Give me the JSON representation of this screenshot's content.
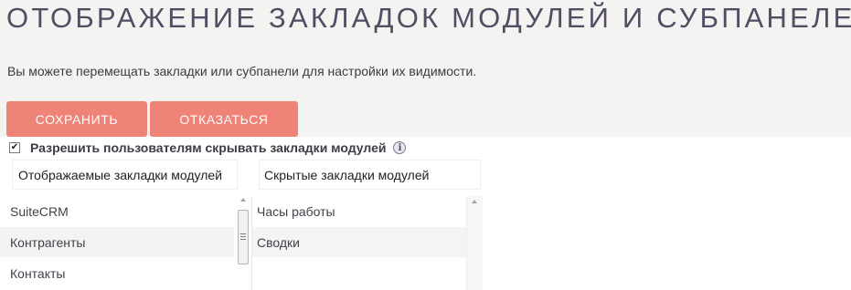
{
  "page": {
    "title": "ОТОБРАЖЕНИЕ ЗАКЛАДОК МОДУЛЕЙ И СУБПАНЕЛЕЙ",
    "description": "Вы можете перемещать закладки или субпанели для настройки их видимости."
  },
  "buttons": {
    "save_label": "СОХРАНИТЬ",
    "cancel_label": "ОТКАЗАТЬСЯ"
  },
  "option": {
    "checked": true,
    "checkmark": "✔",
    "label": "Разрешить пользователям скрывать закладки модулей",
    "info_glyph": "i"
  },
  "columns": {
    "displayed": {
      "header": "Отображаемые закладки модулей",
      "items": [
        "SuiteCRM",
        "Контрагенты",
        "Контакты"
      ]
    },
    "hidden": {
      "header": "Скрытые закладки модулей",
      "items": [
        "Часы работы",
        "Сводки"
      ]
    }
  },
  "icons": {
    "info": "info-icon",
    "checkbox": "checkbox-icon",
    "scroll_up": "arrow-up-icon",
    "scroll_grip": "grip-icon"
  },
  "colors": {
    "accent_button": "#f08377",
    "title_text": "#534d64",
    "page_background": "#f5f3f2"
  }
}
